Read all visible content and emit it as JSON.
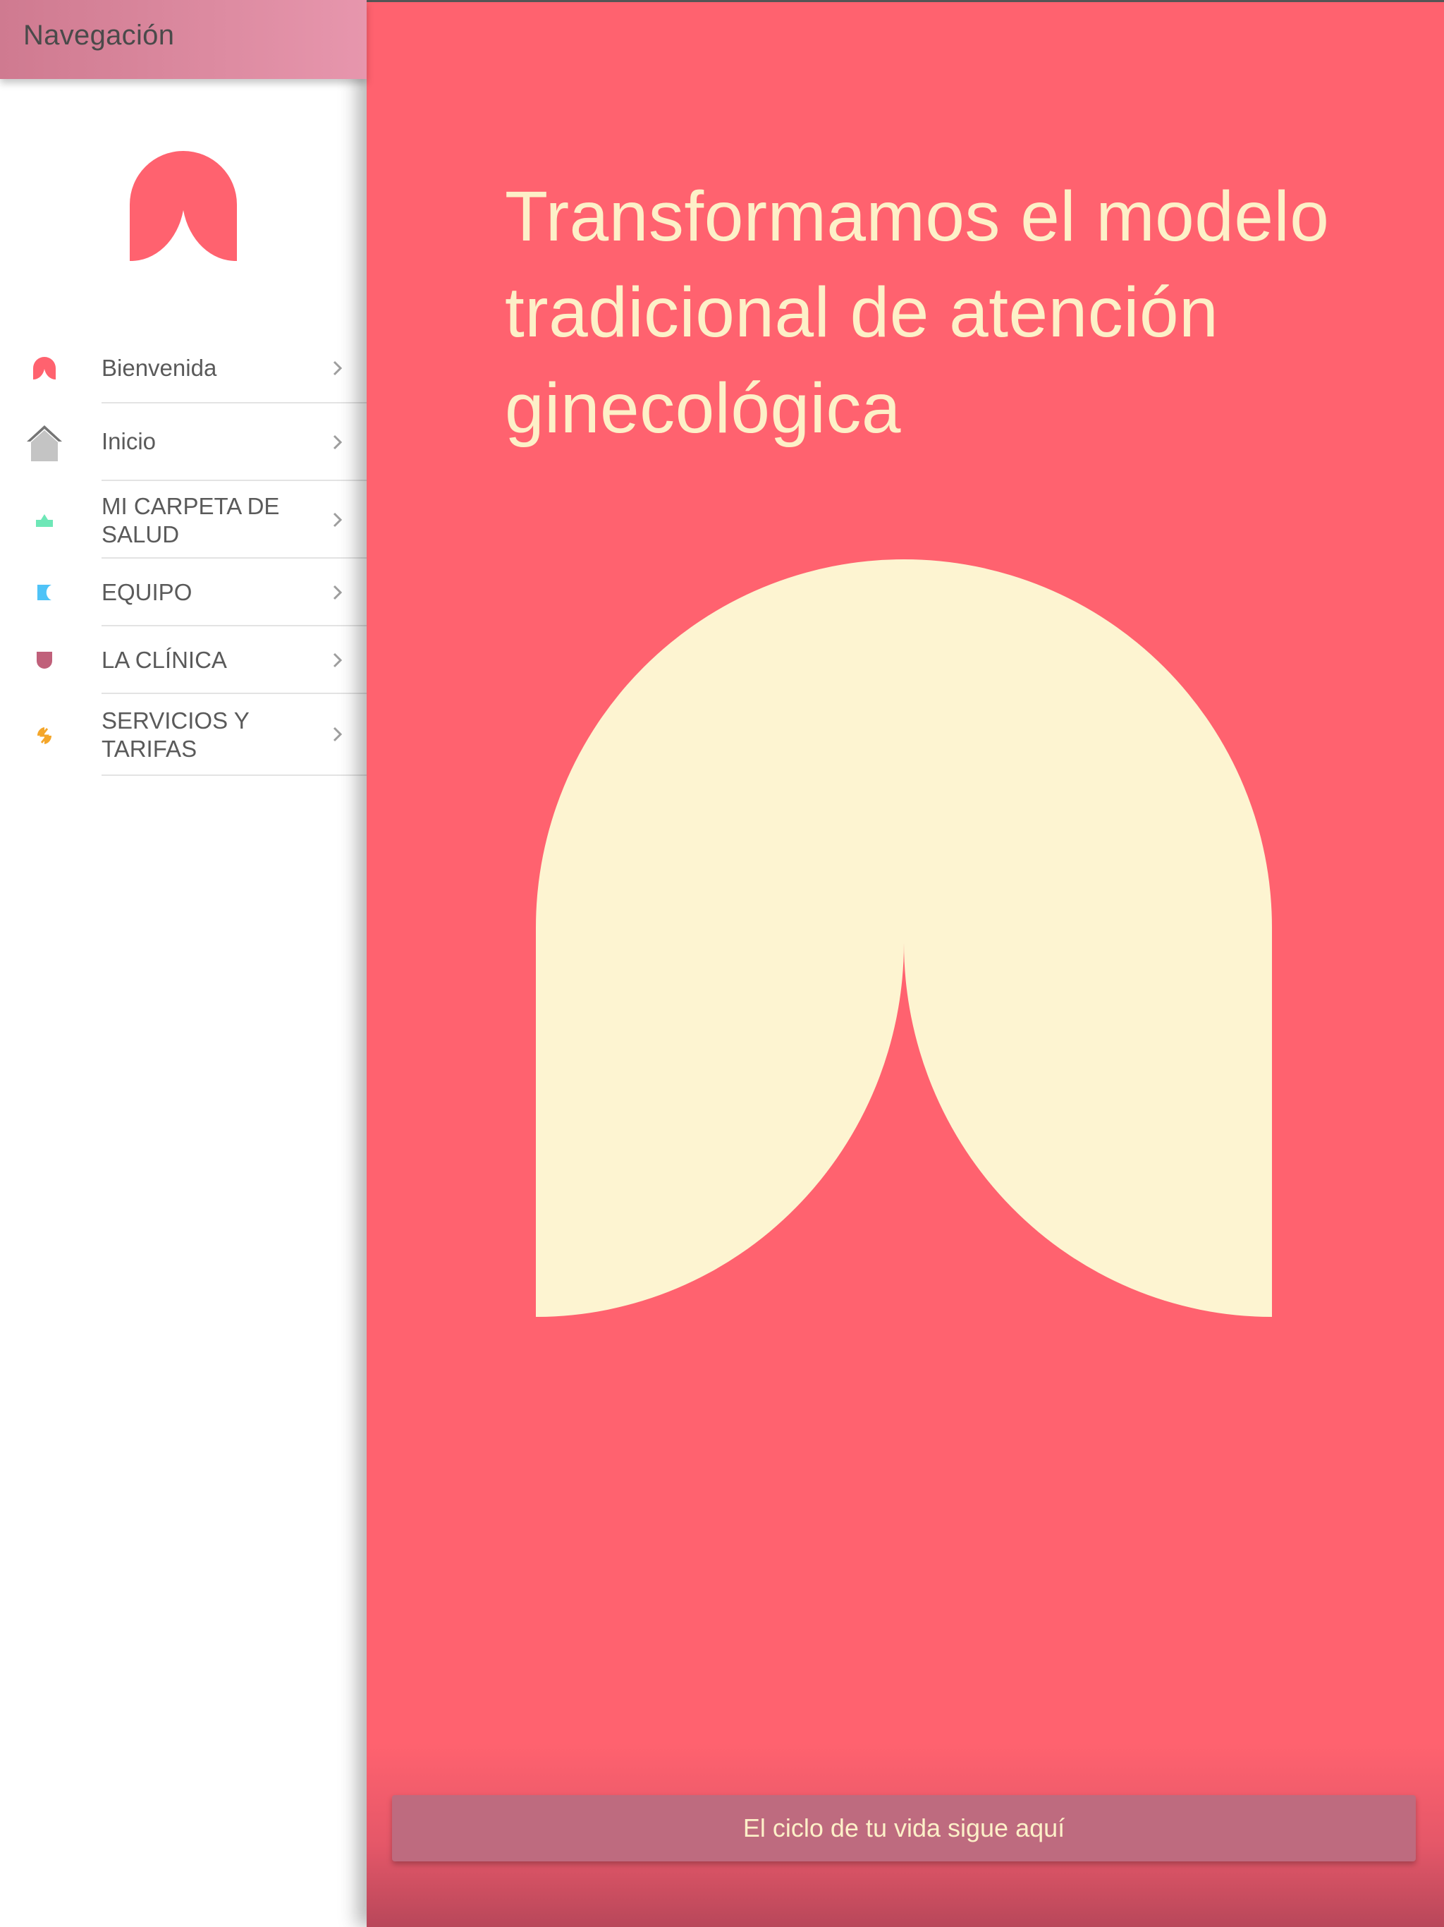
{
  "sidebar": {
    "title": "Navegación",
    "items": [
      {
        "label": "Bienvenida",
        "icon": "brand-arch-icon",
        "color": "#ff626f"
      },
      {
        "label": "Inicio",
        "icon": "home-icon",
        "color": "#bdbdbd"
      },
      {
        "label": "MI CARPETA DE SALUD",
        "icon": "folder-health-icon",
        "color": "#6ee7b7"
      },
      {
        "label": "EQUIPO",
        "icon": "team-icon",
        "color": "#4fc3f7"
      },
      {
        "label": "LA CLÍNICA",
        "icon": "clinic-icon",
        "color": "#c0607a"
      },
      {
        "label": "SERVICIOS Y TARIFAS",
        "icon": "services-icon",
        "color": "#f4a62a"
      }
    ]
  },
  "main": {
    "title": "Transformamos el modelo tradicional de atención ginecológica",
    "cta_label": "El ciclo de tu vida sigue aquí"
  },
  "colors": {
    "brand": "#ff626f",
    "cream": "#fdf0c8",
    "button": "#be6b7f",
    "header": "#dd8ba1"
  }
}
